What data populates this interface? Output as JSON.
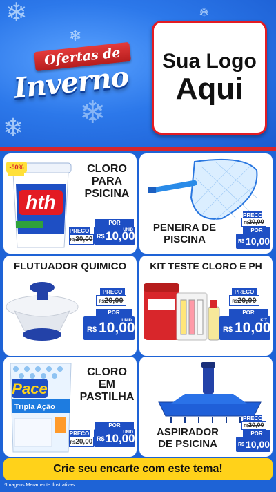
{
  "header": {
    "title_top": "Ofertas de",
    "title_bottom": "Inverno",
    "logo_line1": "Sua Logo",
    "logo_line2": "Aqui"
  },
  "products": [
    {
      "name": [
        "CLORO",
        "PARA",
        "PSICINA"
      ],
      "badge": "-50%",
      "brand": "hth",
      "price_label": "PRECO",
      "price_old": "20,00",
      "price_now_label": "POR",
      "price_new": "10,00",
      "currency": "R$",
      "old_prefix": "R$",
      "unit": "UNID"
    },
    {
      "name": [
        "PENEIRA DE",
        "PISCINA"
      ],
      "price_label": "PRECO",
      "price_old": "20,00",
      "price_now_label": "POR",
      "price_new": "10,00",
      "currency": "R$",
      "old_prefix": "R$"
    },
    {
      "name": [
        "FLUTUADOR QUIMICO"
      ],
      "price_label": "PRECO",
      "price_old": "20,00",
      "price_now_label": "POR",
      "price_new": "10,00",
      "currency": "R$",
      "old_prefix": "R$",
      "unit": "UNID"
    },
    {
      "name": [
        "KIT TESTE CLORO E PH"
      ],
      "price_label": "PRECO",
      "price_old": "20,00",
      "price_now_label": "POR",
      "price_new": "10,00",
      "currency": "R$",
      "old_prefix": "R$",
      "unit": "KIT"
    },
    {
      "name": [
        "CLORO",
        "EM",
        "PASTILHA"
      ],
      "brand": "Pace",
      "brand_sub": "Tripla Ação",
      "price_label": "PRECO",
      "price_old": "20,00",
      "price_now_label": "POR",
      "price_new": "10,00",
      "currency": "R$",
      "old_prefix": "R$",
      "unit": "UNID"
    },
    {
      "name": [
        "ASPIRADOR",
        "DE PSICINA"
      ],
      "price_label": "PRECO",
      "price_old": "20,00",
      "price_now_label": "POR",
      "price_new": "10,00",
      "currency": "R$",
      "old_prefix": "R$"
    }
  ],
  "footer": {
    "cta": "Crie seu encarte com este tema!",
    "disclaimer": "*Imagens Meramente Ilustrativas"
  },
  "colors": {
    "background": "#1e63d6",
    "accent_red": "#d8262b",
    "price_blue": "#1e4fc4",
    "cta_yellow": "#ffd21a"
  }
}
